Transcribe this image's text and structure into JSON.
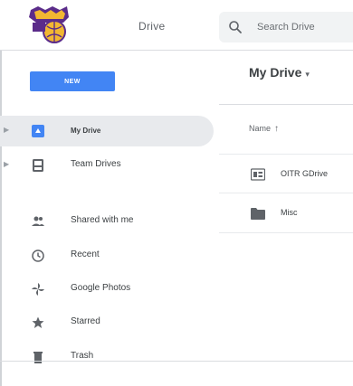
{
  "header": {
    "app_name": "Drive",
    "search": {
      "placeholder": "Search Drive",
      "value": ""
    }
  },
  "toolbar": {
    "new_label": "NEW",
    "location_title": "My Drive",
    "location_caret": "▾"
  },
  "sidebar": {
    "items": [
      {
        "label": "My Drive",
        "icon": "my-drive-icon",
        "active": true,
        "expandable": true
      },
      {
        "label": "Team Drives",
        "icon": "team-drives-icon",
        "active": false,
        "expandable": true
      },
      {
        "label": "Shared with me",
        "icon": "shared-with-me-icon",
        "active": false,
        "expandable": false
      },
      {
        "label": "Recent",
        "icon": "clock-icon",
        "active": false,
        "expandable": false
      },
      {
        "label": "Google Photos",
        "icon": "pinwheel-icon",
        "active": false,
        "expandable": false
      },
      {
        "label": "Starred",
        "icon": "star-icon",
        "active": false,
        "expandable": false
      },
      {
        "label": "Trash",
        "icon": "trash-icon",
        "active": false,
        "expandable": false
      }
    ]
  },
  "files": {
    "column_header": "Name",
    "sort_arrow": "↑",
    "rows": [
      {
        "name": "OITR GDrive",
        "icon": "shared-folder-icon"
      },
      {
        "name": "Misc",
        "icon": "folder-icon"
      }
    ]
  },
  "colors": {
    "accent": "#4285f4",
    "active_bg": "#e8eaed",
    "logo_purple": "#5b2c8a",
    "logo_gold": "#f2b731"
  }
}
